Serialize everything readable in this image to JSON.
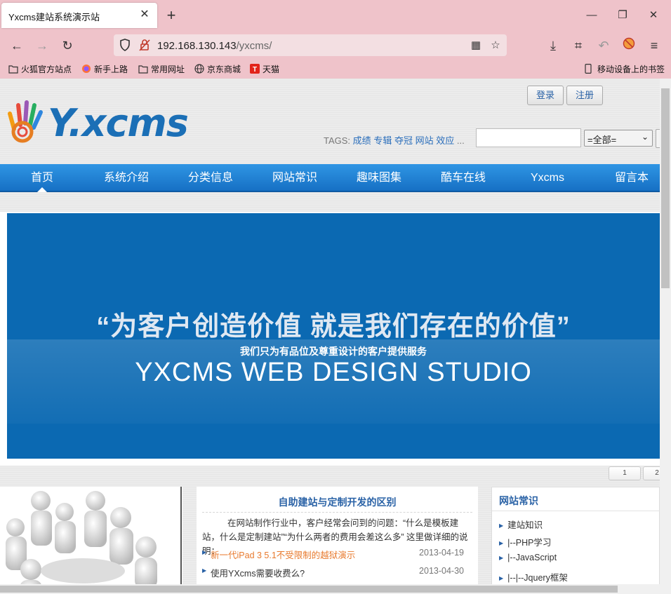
{
  "browser": {
    "tab_title": "Yxcms建站系统演示站",
    "url_host": "192.168.130.143",
    "url_path": "/yxcms/",
    "bookmarks": [
      "火狐官方站点",
      "新手上路",
      "常用网址",
      "京东商城",
      "天猫"
    ],
    "mobile_bookmarks": "移动设备上的书签"
  },
  "header": {
    "login": "登录",
    "register": "注册",
    "logo_text": "Y.xcms",
    "tags_label": "TAGS:",
    "tags": [
      "成绩",
      "专辑",
      "夺冠",
      "网站",
      "效应",
      "..."
    ],
    "search_select": "=全部="
  },
  "menu": [
    "首页",
    "系统介绍",
    "分类信息",
    "网站常识",
    "趣味图集",
    "酷车在线",
    "Yxcms",
    "留言本"
  ],
  "banner": {
    "quote": "“为客户创造价值  就是我们存在的价值”",
    "subtitle": "我们只为有品位及尊重设计的客户提供服务",
    "english": "YXCMS WEB DESIGN STUDIO"
  },
  "pager": [
    "1",
    "2"
  ],
  "mid": {
    "title": "自助建站与定制开发的区别",
    "body": "在网站制作行业中，客户经常会问到的问题：“什么是模板建站，什么是定制建站”“为什么两者的费用会差这么多” 这里做详细的说明：",
    "news": [
      {
        "title": "新一代iPad 3 5.1不受限制的越狱演示",
        "date": "2013-04-19",
        "highlight": true
      },
      {
        "title": "使用YXcms需要收费么?",
        "date": "2013-04-30",
        "highlight": false
      }
    ]
  },
  "side": {
    "title": "网站常识",
    "items": [
      "建站知识",
      "|--PHP学习",
      "|--JavaScript",
      "|--|--Jquery框架"
    ]
  },
  "colors": {
    "chrome": "#efc3ca",
    "menu_blue": "#1f80d4",
    "banner_blue": "#0b69b2",
    "link_blue": "#2a62a6",
    "highlight_orange": "#e87a2e"
  }
}
